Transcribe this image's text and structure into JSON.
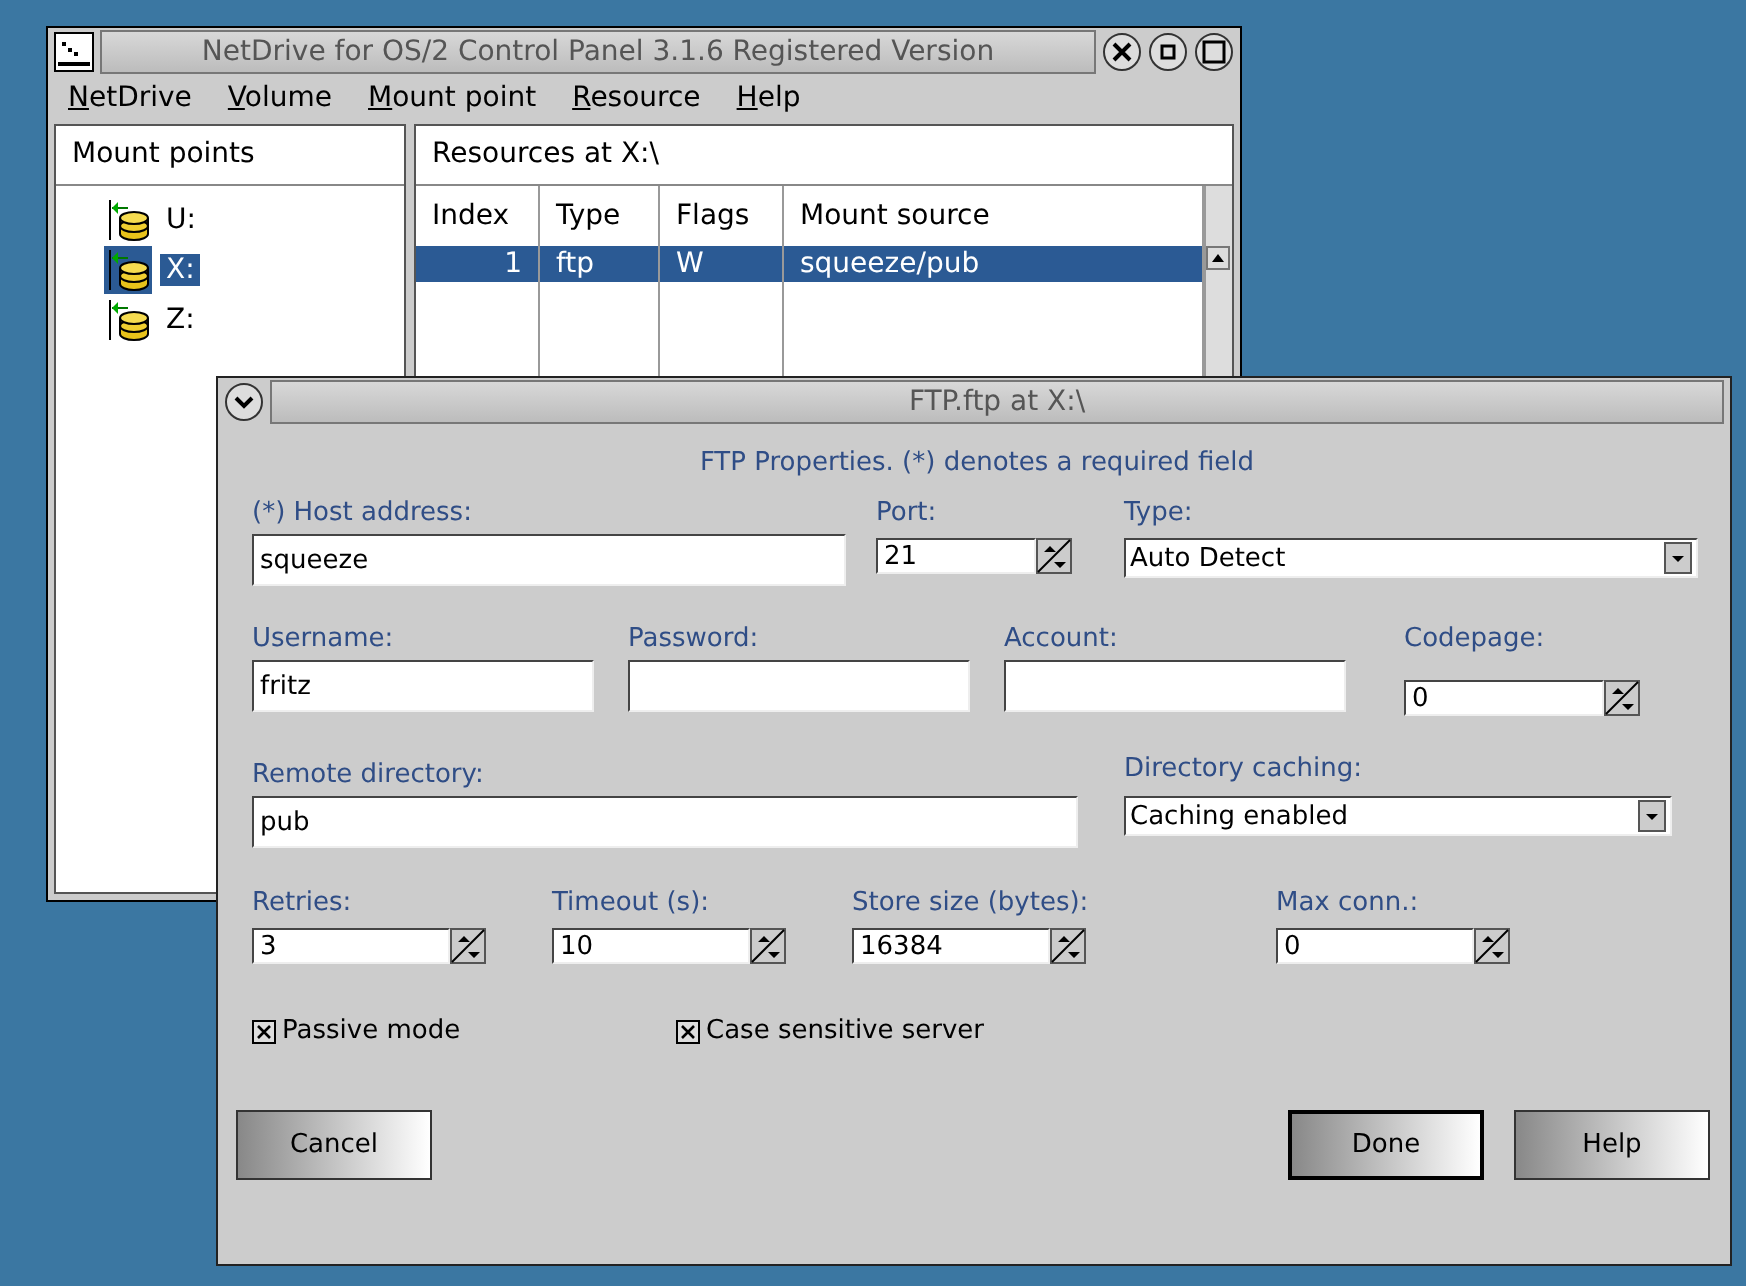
{
  "main_window": {
    "title": "NetDrive for OS/2 Control Panel 3.1.6 Registered Version",
    "menu": [
      "NetDrive",
      "Volume",
      "Mount point",
      "Resource",
      "Help"
    ],
    "mount_points": {
      "title": "Mount points",
      "items": [
        {
          "label": "U:",
          "selected": false
        },
        {
          "label": "X:",
          "selected": true
        },
        {
          "label": "Z:",
          "selected": false
        }
      ]
    },
    "resources": {
      "title": "Resources at X:\\",
      "columns": [
        "Index",
        "Type",
        "Flags",
        "Mount source"
      ],
      "rows": [
        {
          "cells": [
            "1",
            "ftp",
            "W",
            "squeeze/pub"
          ],
          "selected": true
        }
      ]
    }
  },
  "dialog": {
    "title": "FTP.ftp at X:\\",
    "heading": "FTP Properties. (*) denotes a required field",
    "rows": [
      [
        {
          "kind": "text",
          "label": "(*) Host address:",
          "value": "squeeze"
        },
        {
          "kind": "spin",
          "label": "Port:",
          "value": "21"
        },
        {
          "kind": "combo",
          "label": "Type:",
          "value": "Auto Detect"
        }
      ],
      [
        {
          "kind": "text",
          "label": "Username:",
          "value": "fritz"
        },
        {
          "kind": "text",
          "label": "Password:"
        },
        {
          "kind": "text",
          "label": "Account:"
        },
        {
          "kind": "spin",
          "label": "Codepage:",
          "value": "0"
        }
      ],
      [
        {
          "kind": "text",
          "label": "Remote directory:",
          "value": "pub"
        },
        {
          "kind": "combo",
          "label": "Directory caching:",
          "value": "Caching enabled"
        }
      ],
      [
        {
          "kind": "spin",
          "label": "Retries:",
          "value": "3"
        },
        {
          "kind": "spin",
          "label": "Timeout (s):",
          "value": "10"
        },
        {
          "kind": "spin",
          "label": "Store size (bytes):",
          "value": "16384"
        },
        {
          "kind": "spin",
          "label": "Max conn.:",
          "value": "0"
        }
      ]
    ],
    "checkboxes": [
      {
        "label": "Passive mode",
        "checked": true
      },
      {
        "label": "Case sensitive server",
        "checked": true
      }
    ],
    "buttons": [
      {
        "label": "Cancel",
        "default": false
      },
      {
        "label": "Done",
        "default": true
      },
      {
        "label": "Help",
        "default": false
      }
    ]
  }
}
